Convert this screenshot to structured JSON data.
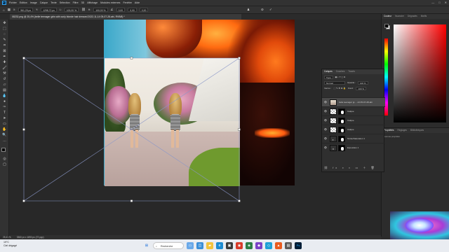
{
  "app": {
    "logo": "Ps",
    "menu": [
      "Fichier",
      "Edition",
      "Image",
      "Calque",
      "Texte",
      "Sélection",
      "Filtre",
      "3D",
      "Affichage",
      "Modules externes",
      "Fenêtre",
      "Aide"
    ],
    "window_controls": [
      "—",
      "□",
      "✕"
    ]
  },
  "options": {
    "x_label": "X:",
    "x_value": "961,25 px",
    "y_label": "Y:",
    "y_value": "1298,72 px",
    "w_label": "L:",
    "w_value": "100,00 %",
    "h_label": "H:",
    "h_value": "100,00 %",
    "angle_value": "0,00",
    "h_skew": "0,00",
    "v_skew": "0,00"
  },
  "document": {
    "tab_title": "08232.png @ 25,4% (belle teenager girls with curly blonde hair dressed 2022-11-14 05-07-28-abi, RVB/8) *"
  },
  "status": {
    "zoom": "25,41 %",
    "dims": "3360 px x 1890 px (72 ppp)"
  },
  "color_panel": {
    "tabs": [
      "Couleur",
      "Nuancier",
      "Dégradés",
      "Motifs"
    ]
  },
  "props_panel": {
    "tabs": [
      "Propriétés",
      "Réglages",
      "Bibliothèques"
    ],
    "message": "Aucune propriété"
  },
  "layers_panel": {
    "tabs": [
      "Calques",
      "Couches",
      "Tracés"
    ],
    "kind_label": "Type",
    "blend_mode": "Normal",
    "opacity_label": "Opacité :",
    "opacity_value": "100 %",
    "lock_label": "Verrou :",
    "fill_label": "Fond :",
    "fill_value": "100 %",
    "layers": [
      {
        "name": "belle teenager gi... -14 05-07-28-abi",
        "kind": "photo",
        "selected": true,
        "mask": false
      },
      {
        "name": "Calque",
        "kind": "transparent",
        "selected": false,
        "mask": true
      },
      {
        "name": "Calque",
        "kind": "transparent",
        "selected": false,
        "mask": true
      },
      {
        "name": "Calque",
        "kind": "transparent",
        "selected": false,
        "mask": true
      },
      {
        "name": "Teinte/Saturation 1",
        "kind": "adjustment",
        "selected": false,
        "mask": true
      },
      {
        "name": "Exposition 1",
        "kind": "adjustment",
        "selected": false,
        "mask": true
      }
    ]
  },
  "taskbar": {
    "weather_temp": "19°C",
    "weather_desc": "Ciel dégagé",
    "search_label": "Recherche",
    "time": "",
    "date": ""
  },
  "colors": {
    "foreground": "#000000",
    "background": "#ffffff",
    "accent": "#31a8ff"
  }
}
